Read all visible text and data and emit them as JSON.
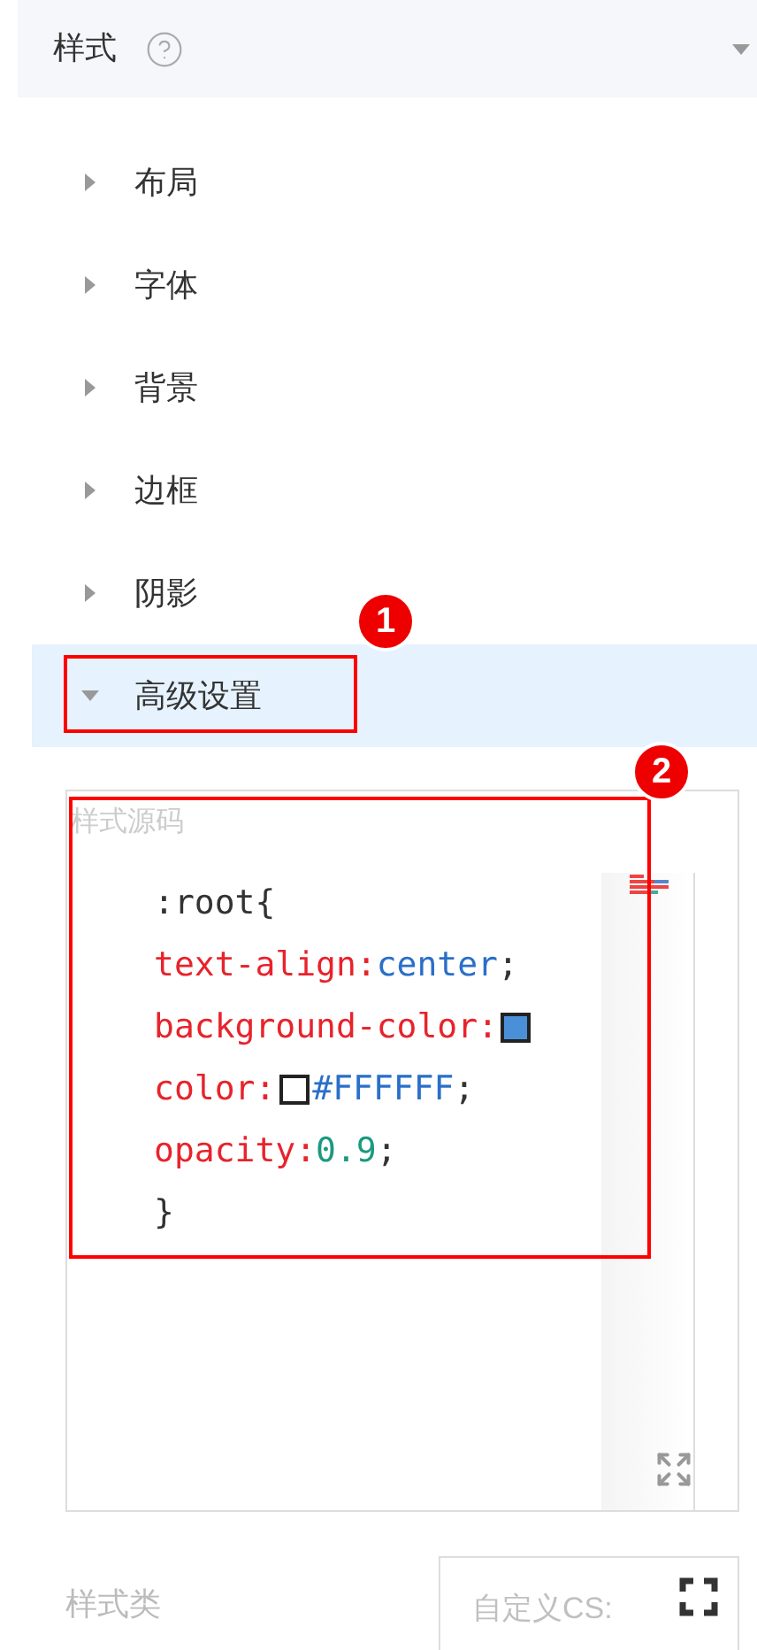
{
  "header": {
    "title": "样式",
    "expanded": true
  },
  "sections": [
    {
      "label": "布局",
      "expanded": false,
      "selected": false
    },
    {
      "label": "字体",
      "expanded": false,
      "selected": false
    },
    {
      "label": "背景",
      "expanded": false,
      "selected": false
    },
    {
      "label": "边框",
      "expanded": false,
      "selected": false
    },
    {
      "label": "阴影",
      "expanded": false,
      "selected": false
    },
    {
      "label": "高级设置",
      "expanded": true,
      "selected": true
    }
  ],
  "style_source": {
    "label": "样式源码",
    "lines": [
      [
        {
          "kind": "punct",
          "text": ":root{"
        }
      ],
      [
        {
          "kind": "property",
          "text": "text-align:"
        },
        {
          "kind": "value",
          "text": "center"
        },
        {
          "kind": "punct",
          "text": ";"
        }
      ],
      [
        {
          "kind": "property",
          "text": "background-color:"
        },
        {
          "kind": "swatch",
          "color": "#4a90d9"
        }
      ],
      [
        {
          "kind": "property",
          "text": "color:"
        },
        {
          "kind": "swatch",
          "color": "#ffffff"
        },
        {
          "kind": "value",
          "text": "#FFFFFF"
        },
        {
          "kind": "punct",
          "text": ";"
        }
      ],
      [
        {
          "kind": "property",
          "text": "opacity:"
        },
        {
          "kind": "number",
          "text": "0.9"
        },
        {
          "kind": "punct",
          "text": ";"
        }
      ],
      [
        {
          "kind": "punct",
          "text": "}"
        }
      ]
    ]
  },
  "style_class": {
    "label": "样式类",
    "placeholder": "自定义CS:"
  },
  "annotations": [
    {
      "label": "1"
    },
    {
      "label": "2"
    }
  ]
}
